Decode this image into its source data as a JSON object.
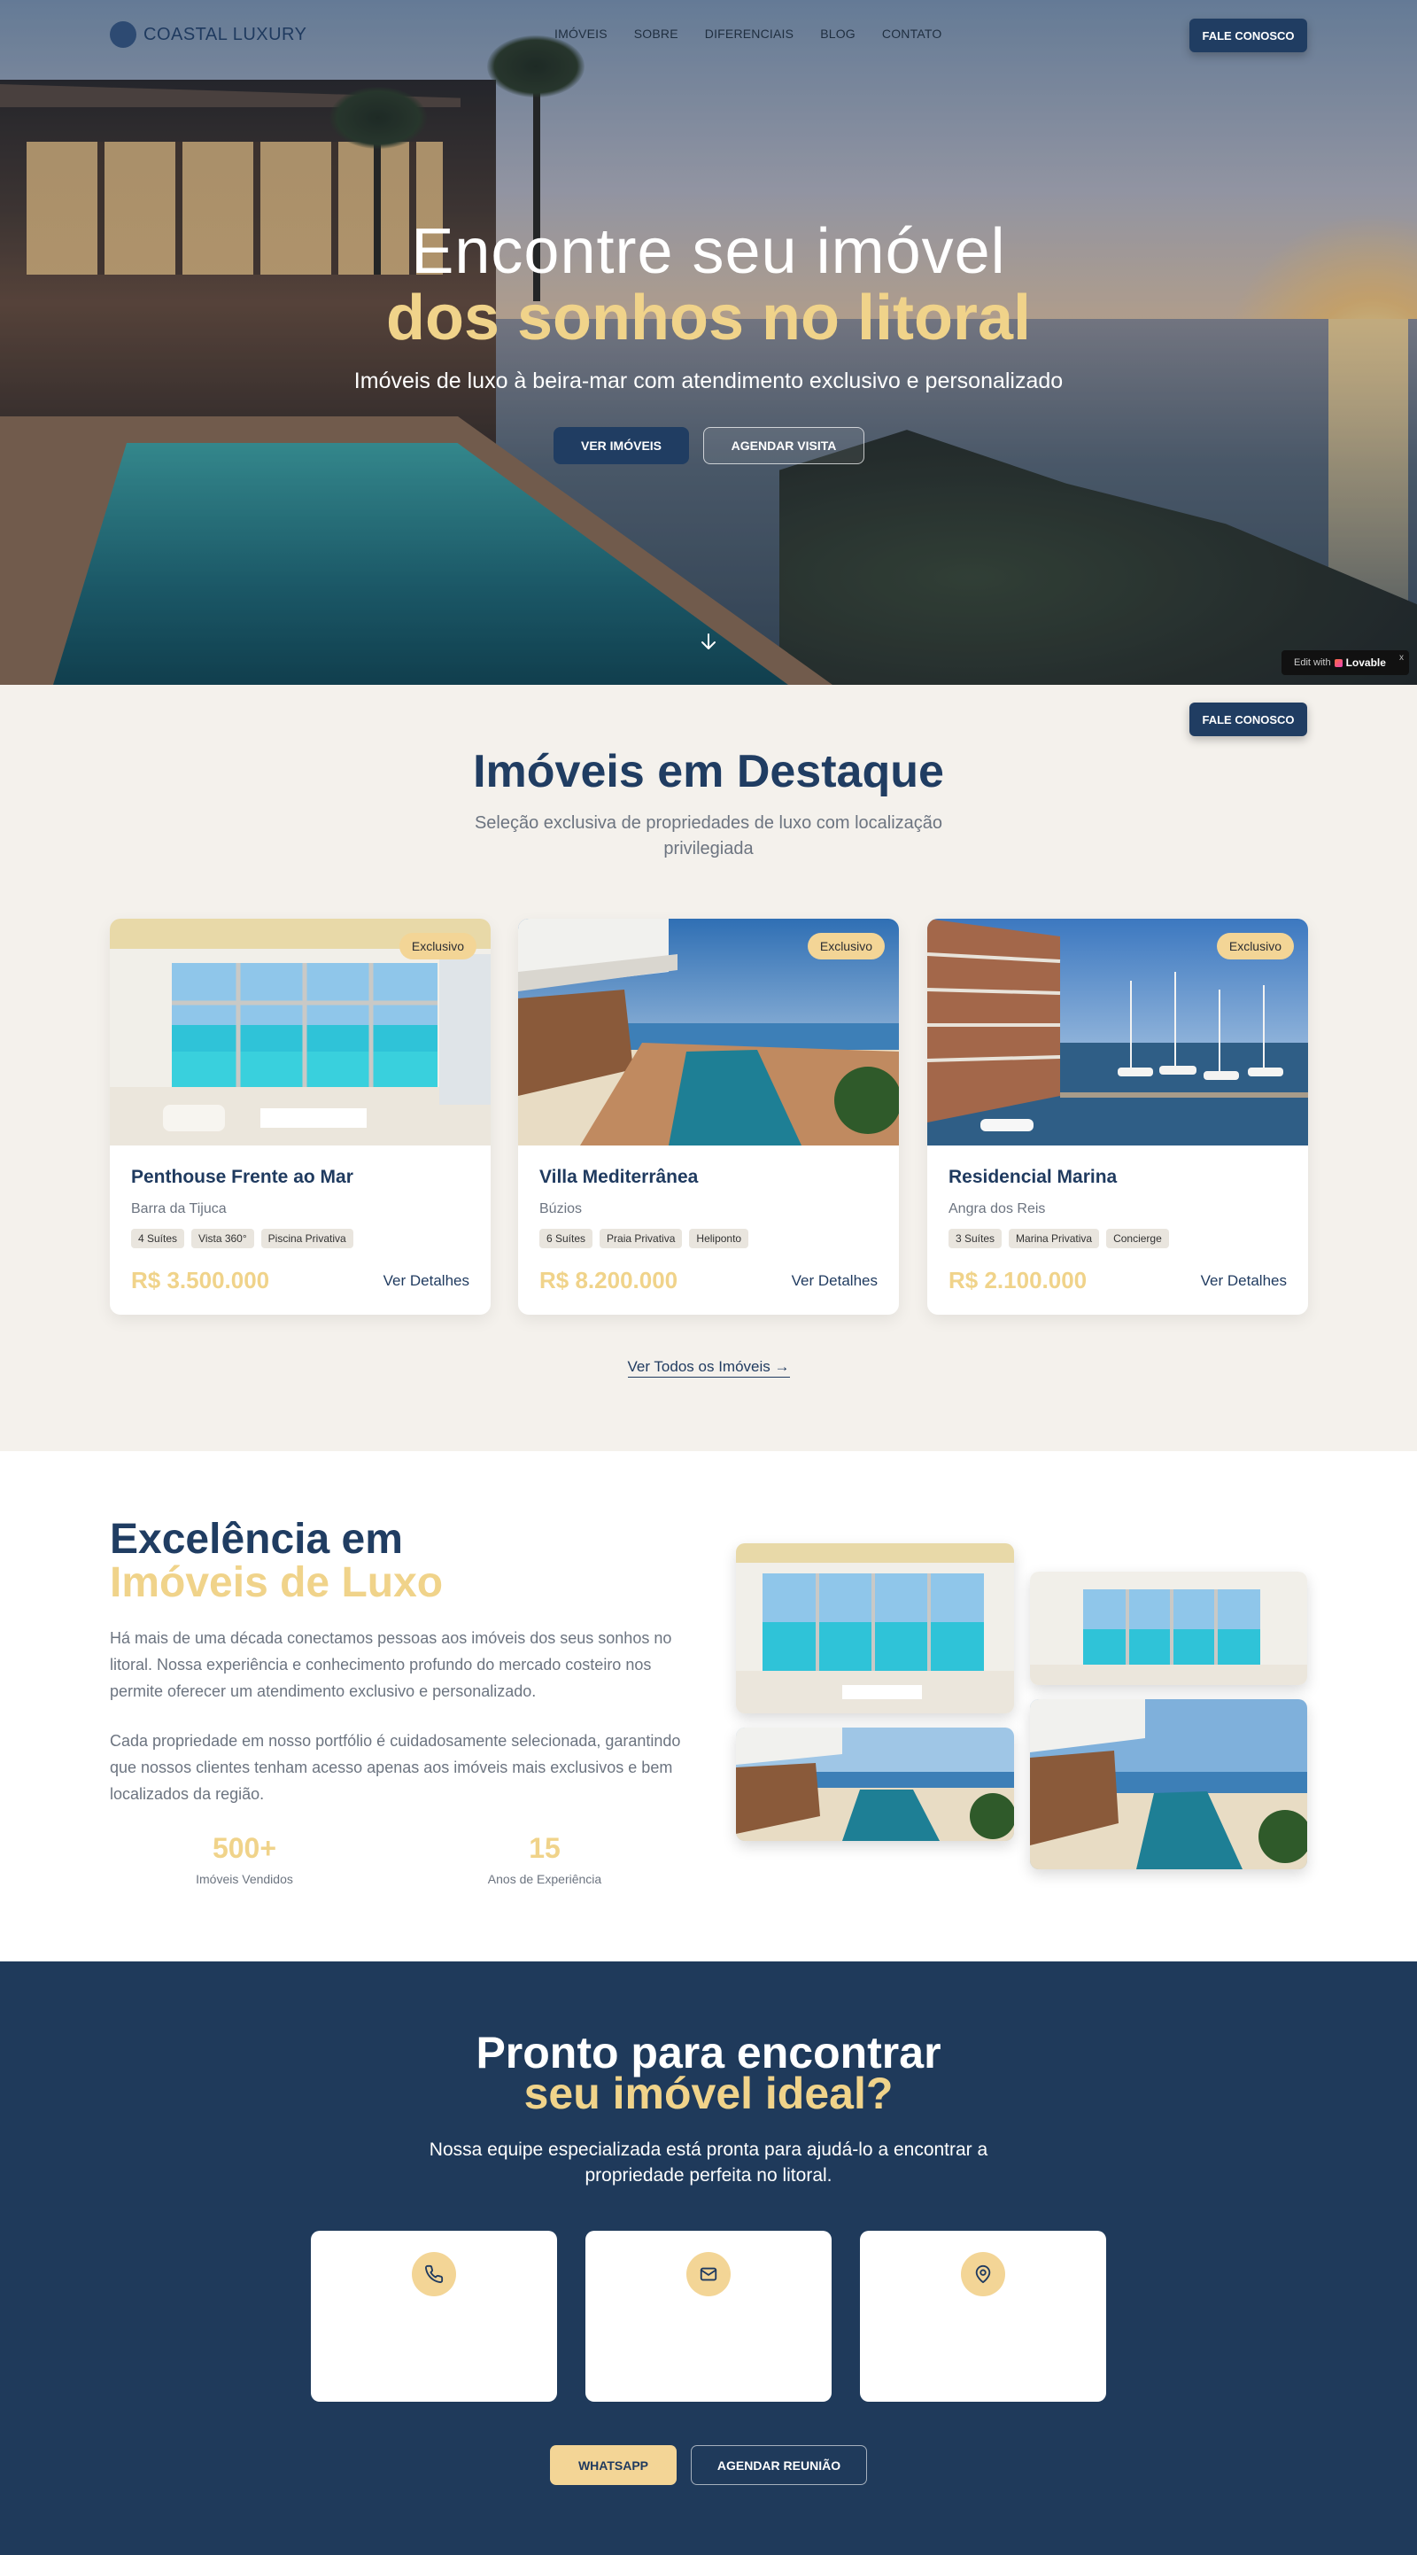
{
  "brand": {
    "name": "COASTAL LUXURY"
  },
  "nav": {
    "links": [
      "IMÓVEIS",
      "SOBRE",
      "DIFERENCIAIS",
      "BLOG",
      "CONTATO"
    ],
    "cta": "FALE CONOSCO"
  },
  "hero": {
    "title_line1": "Encontre seu imóvel",
    "title_line2": "dos sonhos no litoral",
    "subtitle": "Imóveis de luxo à beira-mar com atendimento exclusivo e personalizado",
    "primary_button": "VER IMÓVEIS",
    "secondary_button": "AGENDAR VISITA",
    "scroll_icon": "arrow-down-icon"
  },
  "floating_cta": "FALE CONOSCO",
  "lovable_badge": {
    "prefix": "Edit with",
    "brand": "Lovable",
    "close": "x"
  },
  "featured": {
    "title": "Imóveis em Destaque",
    "subtitle": "Seleção exclusiva de propriedades de luxo com localização privilegiada",
    "cards": [
      {
        "badge": "Exclusivo",
        "title": "Penthouse Frente ao Mar",
        "location": "Barra da Tijuca",
        "tags": [
          "4 Suítes",
          "Vista 360°",
          "Piscina Privativa"
        ],
        "price": "R$ 3.500.000",
        "link": "Ver Detalhes"
      },
      {
        "badge": "Exclusivo",
        "title": "Villa Mediterrânea",
        "location": "Búzios",
        "tags": [
          "6 Suítes",
          "Praia Privativa",
          "Heliponto"
        ],
        "price": "R$ 8.200.000",
        "link": "Ver Detalhes"
      },
      {
        "badge": "Exclusivo",
        "title": "Residencial Marina",
        "location": "Angra dos Reis",
        "tags": [
          "3 Suítes",
          "Marina Privativa",
          "Concierge"
        ],
        "price": "R$ 2.100.000",
        "link": "Ver Detalhes"
      }
    ],
    "see_all": "Ver Todos os Imóveis →"
  },
  "about": {
    "title_line1": "Excelência em",
    "title_line2": "Imóveis de Luxo",
    "paragraph1": "Há mais de uma década conectamos pessoas aos imóveis dos seus sonhos no litoral. Nossa experiência e conhecimento profundo do mercado costeiro nos permite oferecer um atendimento exclusivo e personalizado.",
    "paragraph2": "Cada propriedade em nosso portfólio é cuidadosamente selecionada, garantindo que nossos clientes tenham acesso apenas aos imóveis mais exclusivos e bem localizados da região.",
    "stats": [
      {
        "value": "500+",
        "label": "Imóveis Vendidos"
      },
      {
        "value": "15",
        "label": "Anos de Experiência"
      }
    ]
  },
  "contact": {
    "title_line1": "Pronto para encontrar",
    "title_line2": "seu imóvel ideal?",
    "subtitle": "Nossa equipe especializada está pronta para ajudá-lo a encontrar a propriedade perfeita no litoral.",
    "cards": [
      {
        "icon": "phone-icon"
      },
      {
        "icon": "mail-icon"
      },
      {
        "icon": "map-pin-icon"
      }
    ],
    "whatsapp_button": "WHATSAPP",
    "meeting_button": "AGENDAR REUNIÃO"
  },
  "colors": {
    "navy": "#203d62",
    "gold": "#f0d38a",
    "cream": "#f4f1ec",
    "contact_bg": "#1f3a5b"
  }
}
